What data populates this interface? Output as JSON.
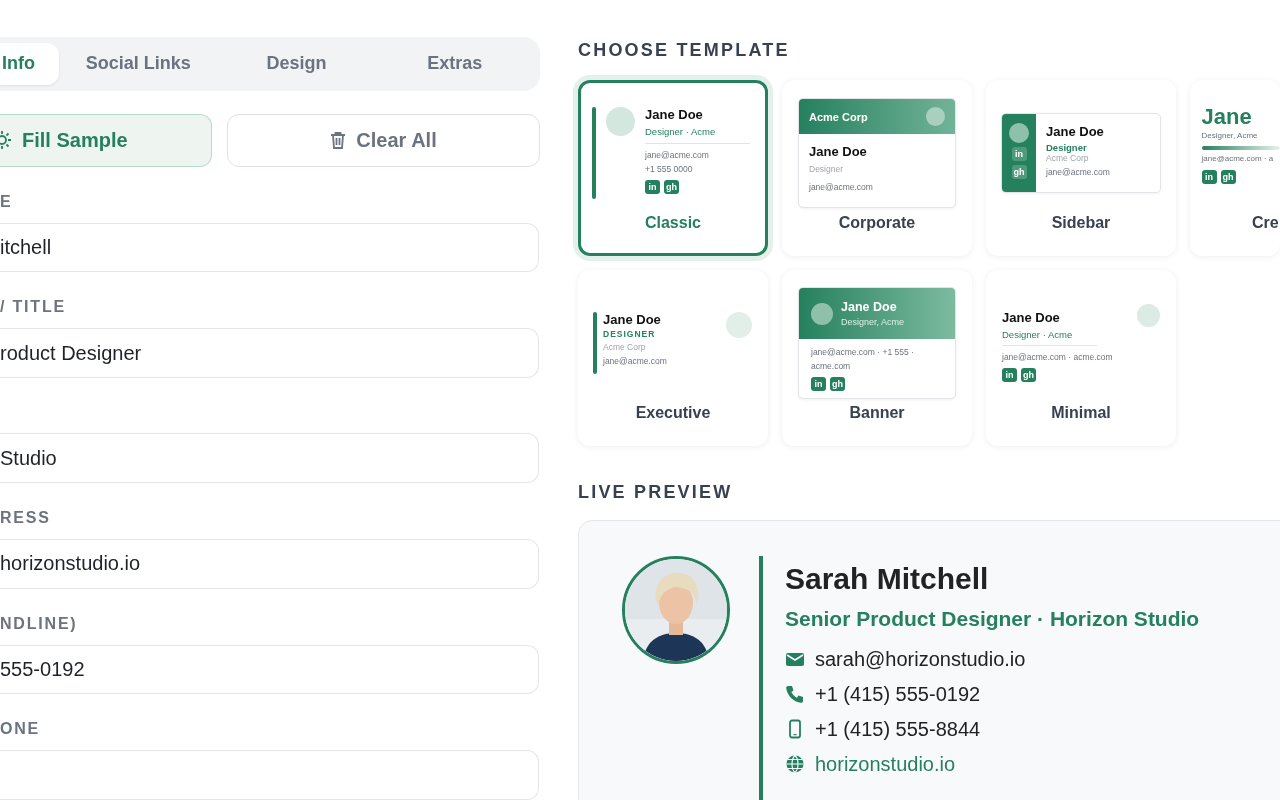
{
  "tabs": [
    {
      "label": "Info",
      "selected": true
    },
    {
      "label": "Social Links",
      "selected": false
    },
    {
      "label": "Design",
      "selected": false
    },
    {
      "label": "Extras",
      "selected": false
    }
  ],
  "actions": [
    {
      "label": "Fill Sample",
      "kind": "fill"
    },
    {
      "label": "Clear All",
      "kind": "clear"
    }
  ],
  "fields": [
    {
      "label": "E",
      "value": "itchell"
    },
    {
      "label": "/ TITLE",
      "value": "roduct Designer"
    },
    {
      "value": "Studio"
    },
    {
      "label": "RESS",
      "value": "horizonstudio.io"
    },
    {
      "label": "NDLINE)",
      "value": "555-0192"
    },
    {
      "label": "ONE"
    }
  ],
  "templates": {
    "heading": "CHOOSE TEMPLATE",
    "items": [
      {
        "label": "Classic",
        "kind": "classic",
        "selected": true,
        "name": "Jane Doe",
        "subtitle": "Designer · Acme",
        "lines": [
          "jane@acme.com",
          "+1 555 0000"
        ],
        "badges": [
          "in",
          "gh"
        ]
      },
      {
        "label": "Corporate",
        "kind": "corporate",
        "selected": false,
        "company": "Acme Corp",
        "name": "Jane Doe",
        "subtitle": "Designer",
        "lines": [
          "jane@acme.com"
        ]
      },
      {
        "label": "Sidebar",
        "kind": "sidebar",
        "selected": false,
        "name": "Jane Doe",
        "subtitle": "Designer",
        "company": "Acme Corp",
        "lines": [
          "jane@acme.com"
        ],
        "badges": [
          "in",
          "gh"
        ]
      },
      {
        "label": "Cre",
        "kind": "creative",
        "selected": false,
        "name": "Jane",
        "subtitle": "Designer, Acme",
        "lines": [
          "jane@acme.com · a"
        ],
        "badges": [
          "in",
          "gh"
        ]
      },
      {
        "label": "Executive",
        "kind": "executive",
        "selected": false,
        "name": "Jane Doe",
        "subtitle": "DESIGNER",
        "company": "Acme Corp",
        "lines": [
          "jane@acme.com"
        ]
      },
      {
        "label": "Banner",
        "kind": "banner",
        "selected": false,
        "name": "Jane Doe",
        "subtitle": "Designer, Acme",
        "lines": [
          "jane@acme.com · +1 555 · acme.com"
        ],
        "badges": [
          "in",
          "gh"
        ]
      },
      {
        "label": "Minimal",
        "kind": "minimal",
        "selected": false,
        "name": "Jane Doe",
        "subtitle": "Designer · Acme",
        "lines": [
          "jane@acme.com · acme.com"
        ],
        "badges": [
          "in",
          "gh"
        ]
      }
    ]
  },
  "preview": {
    "heading": "LIVE PREVIEW",
    "name": "Sarah Mitchell",
    "title": "Senior Product Designer · Horizon Studio",
    "contacts": [
      {
        "kind": "email",
        "text": "sarah@horizonstudio.io"
      },
      {
        "kind": "phone",
        "text": "+1 (415) 555-0192"
      },
      {
        "kind": "mobile",
        "text": "+1 (415) 555-8844"
      },
      {
        "kind": "web",
        "text": "horizonstudio.io"
      }
    ]
  }
}
